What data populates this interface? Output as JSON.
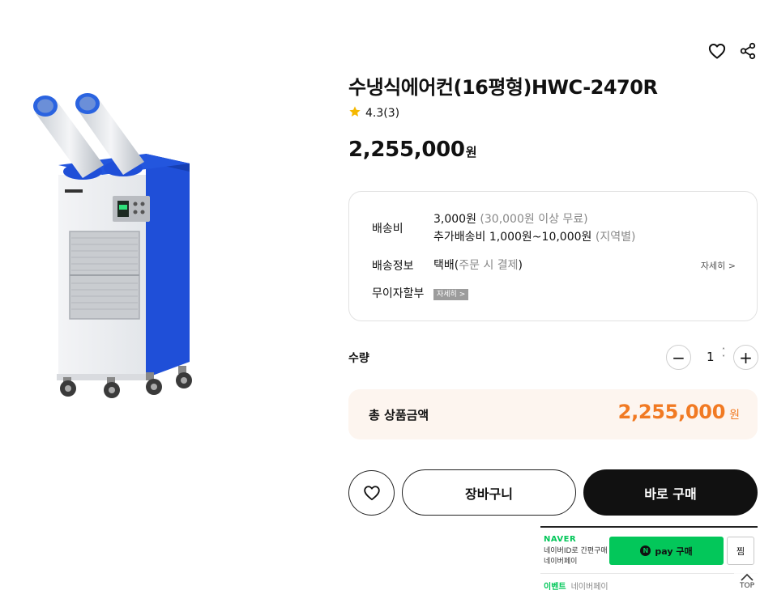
{
  "product": {
    "title": "수냉식에어컨(16평형)HWC-2470R",
    "rating": "4.3(3)",
    "price_number": "2,255,000",
    "price_unit": "원"
  },
  "icons": {
    "wishlist": "heart-icon",
    "share": "share-icon",
    "rating_star": "star-icon"
  },
  "info": {
    "shipping_fee_label": "배송비",
    "shipping_fee_line1_main": "3,000원",
    "shipping_fee_line1_note": "(30,000원 이상 무료)",
    "shipping_fee_line2_main": "추가배송비 1,000원~10,000원",
    "shipping_fee_line2_note": "(지역별)",
    "delivery_label": "배송정보",
    "delivery_main": "택배",
    "delivery_note_open": "(",
    "delivery_note": "주문 시 결제",
    "delivery_note_close": ")",
    "delivery_detail_link": "자세히 >",
    "installment_label": "무이자할부",
    "installment_badge": "자세히 >"
  },
  "quantity": {
    "label": "수량",
    "value": "1",
    "minus": "−",
    "plus": "+",
    "spinner_up": "˄",
    "spinner_down": "˅"
  },
  "total": {
    "label": "총 상품금액",
    "price_number": "2,255,000",
    "price_unit": "원"
  },
  "actions": {
    "cart_label": "장바구니",
    "buy_label": "바로 구매"
  },
  "naver_pay": {
    "brand": "NAVER",
    "desc_line1": "네이버ID로 간편구매",
    "desc_line2": "네이버페이",
    "pay_badge": "N",
    "pay_label": "pay 구매",
    "zzim_label": "찜",
    "event_tag": "이벤트",
    "event_text": "네이버페이"
  },
  "top_button": {
    "label": "TOP"
  },
  "colors": {
    "accent_orange": "#f17a23",
    "naver_green": "#03c75a",
    "star_yellow": "#f5b800",
    "unit_blue": "#1f4fd8"
  }
}
